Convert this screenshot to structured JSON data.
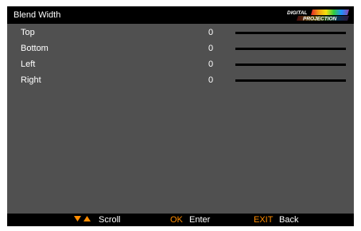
{
  "header": {
    "title": "Blend Width",
    "logo_text": [
      "DIGITAL",
      "PROJECTION"
    ]
  },
  "menu": {
    "items": [
      {
        "label": "Top",
        "value": "0",
        "level": 0
      },
      {
        "label": "Bottom",
        "value": "0",
        "level": 0
      },
      {
        "label": "Left",
        "value": "0",
        "level": 0
      },
      {
        "label": "Right",
        "value": "0",
        "level": 0
      }
    ]
  },
  "footer": {
    "scroll_icon": "down-up-arrows-icon",
    "scroll_label": "Scroll",
    "ok_key": "OK",
    "ok_label": "Enter",
    "exit_key": "EXIT",
    "exit_label": "Back"
  },
  "colors": {
    "panel": "#505050",
    "bar": "#000000",
    "key_accent": "#ff8c00",
    "text": "#ffffff"
  }
}
